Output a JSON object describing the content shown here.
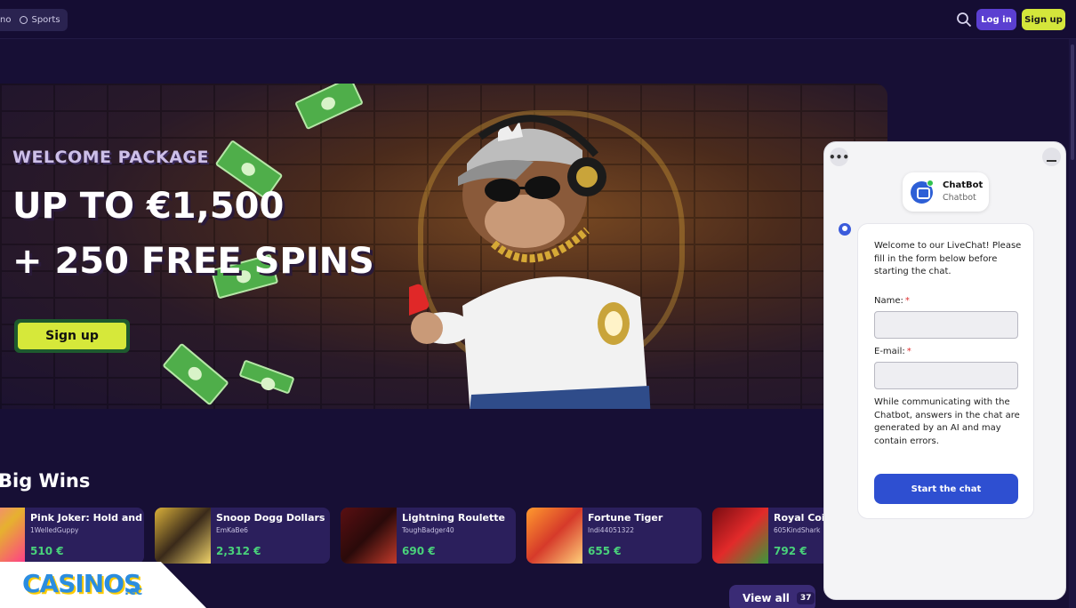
{
  "nav": {
    "partial_item": "no",
    "sports_label": "Sports"
  },
  "header": {
    "login_label": "Log in",
    "signup_label": "Sign up"
  },
  "hero": {
    "subtitle": "WELCOME PACKAGE",
    "title_line1": "UP TO €1,500",
    "title_line2": "+ 250 FREE SPINS",
    "cta_label": "Sign up"
  },
  "big_wins": {
    "heading": "Big Wins",
    "items": [
      {
        "game": "Pink Joker: Hold and ...",
        "user": "1WelledGuppy",
        "amount": "510 €"
      },
      {
        "game": "Snoop Dogg Dollars",
        "user": "EmKaBe6",
        "amount": "2,312 €"
      },
      {
        "game": "Lightning Roulette",
        "user": "ToughBadger40",
        "amount": "690 €"
      },
      {
        "game": "Fortune Tiger",
        "user": "Indi44051322",
        "amount": "655 €"
      },
      {
        "game": "Royal Coins",
        "user": "605KindShark",
        "amount": "792 €"
      }
    ],
    "view_all_label": "View all",
    "view_all_count": "37"
  },
  "logo": {
    "main": "CASINOS",
    "suffix": ".cc"
  },
  "chat": {
    "bot_name": "ChatBot",
    "bot_sub": "Chatbot",
    "intro": "Welcome to our LiveChat! Please fill in the form below before starting the chat.",
    "name_label": "Name:",
    "email_label": "E-mail:",
    "required_mark": "*",
    "note": "While communicating with the Chatbot, answers in the chat are generated by an AI and may contain errors.",
    "start_label": "Start the chat"
  },
  "colors": {
    "accent_green": "#d4e63b",
    "brand_purple": "#5b3fd1",
    "chat_button": "#2e4fd1"
  }
}
